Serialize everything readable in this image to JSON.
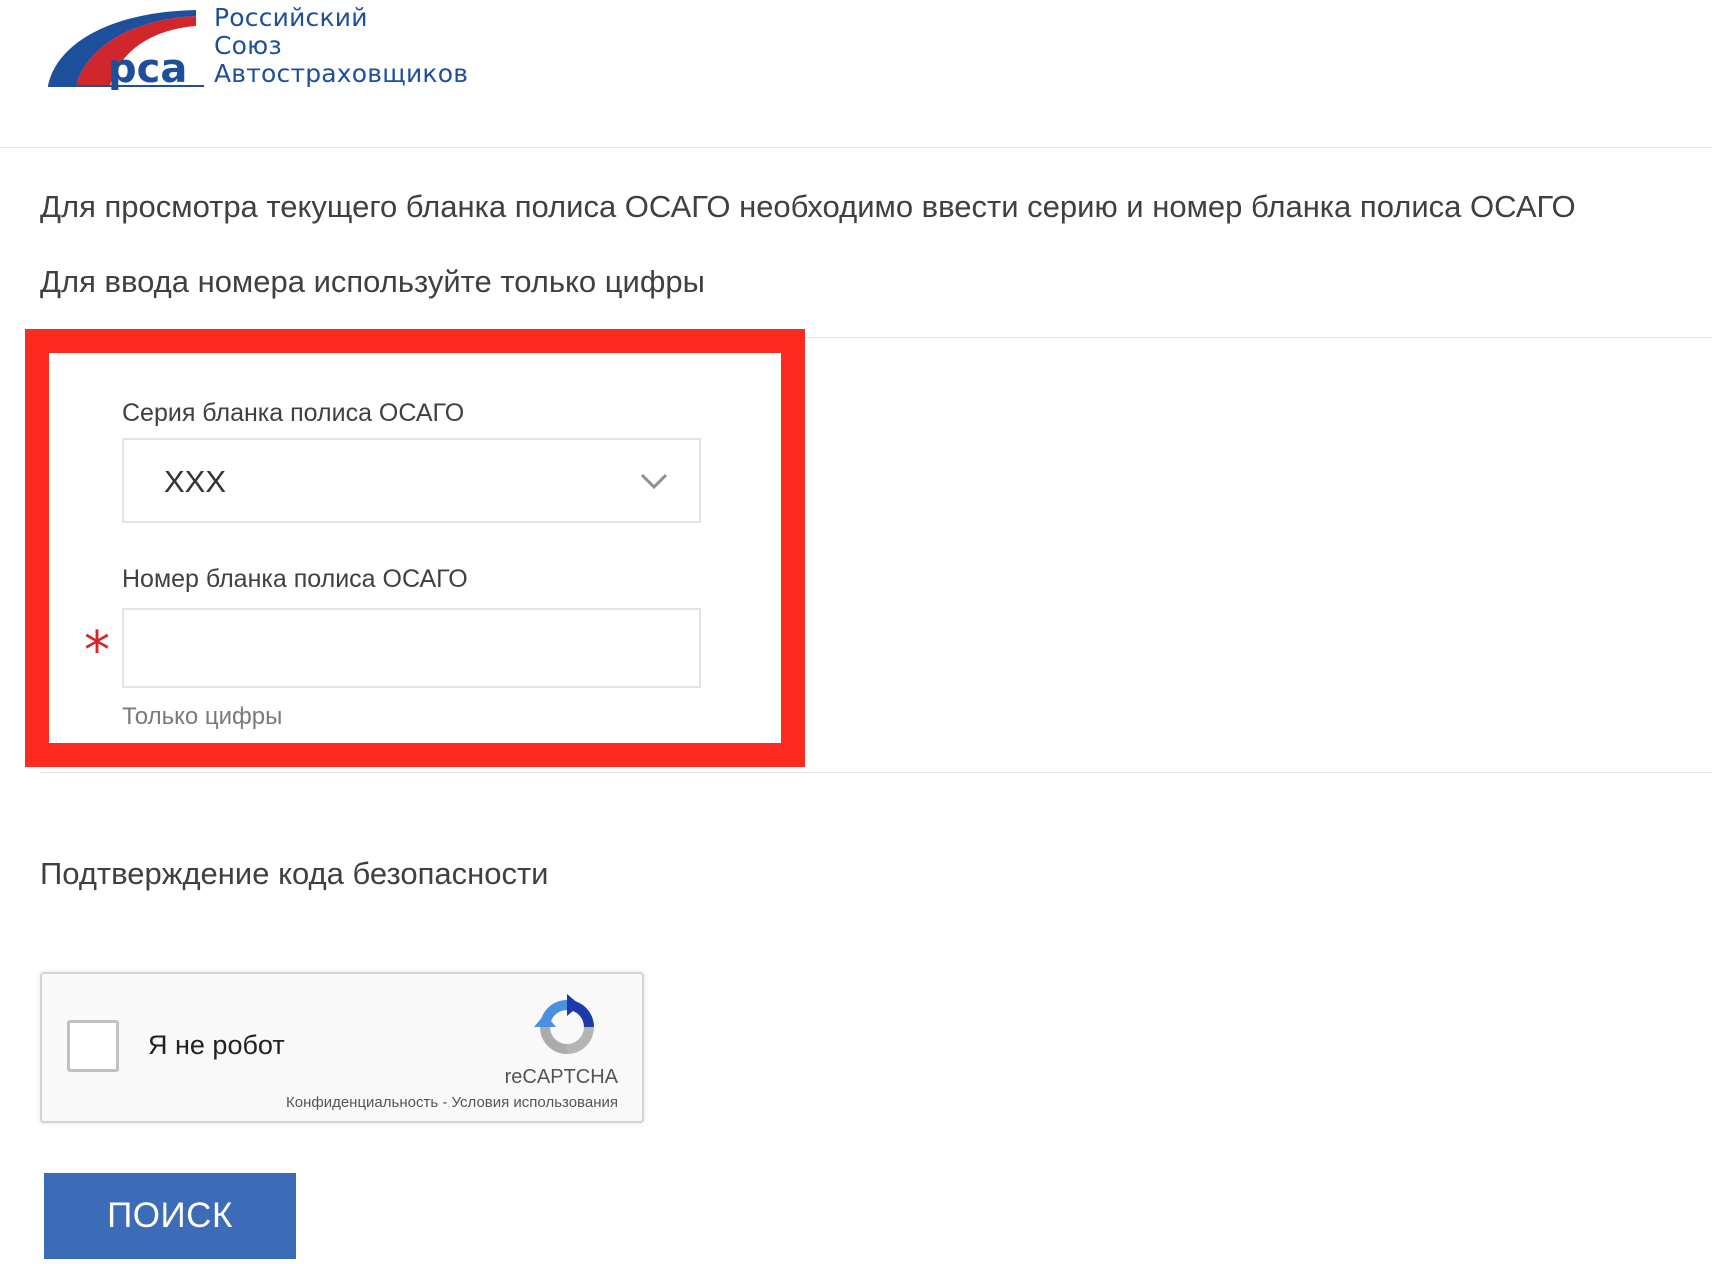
{
  "header": {
    "logo_line1": "Российский",
    "logo_line2": "Союз",
    "logo_line3": "Автостраховщиков",
    "logo_mark_text": "рса",
    "brand_color": "#1d4f9c",
    "brand_red": "#d0262c"
  },
  "instructions": {
    "line1": "Для просмотра текущего бланка полиса ОСАГО необходимо ввести серию и номер бланка полиса ОСАГО",
    "line2": "Для ввода номера используйте только цифры"
  },
  "form": {
    "series_label": "Серия бланка полиса ОСАГО",
    "series_value": "XXX",
    "number_label": "Номер бланка полиса ОСАГО",
    "number_value": "",
    "required_mark": "*",
    "number_hint": "Только цифры",
    "highlight_color": "#ff2a1f"
  },
  "security": {
    "title": "Подтверждение кода безопасности",
    "recaptcha_label": "Я не робот",
    "recaptcha_brand": "reCAPTCHA",
    "privacy_link": "Конфиденциальность",
    "separator": " - ",
    "terms_link": "Условия использования"
  },
  "actions": {
    "search_label": "ПОИСК",
    "button_color": "#3c6bb7"
  }
}
